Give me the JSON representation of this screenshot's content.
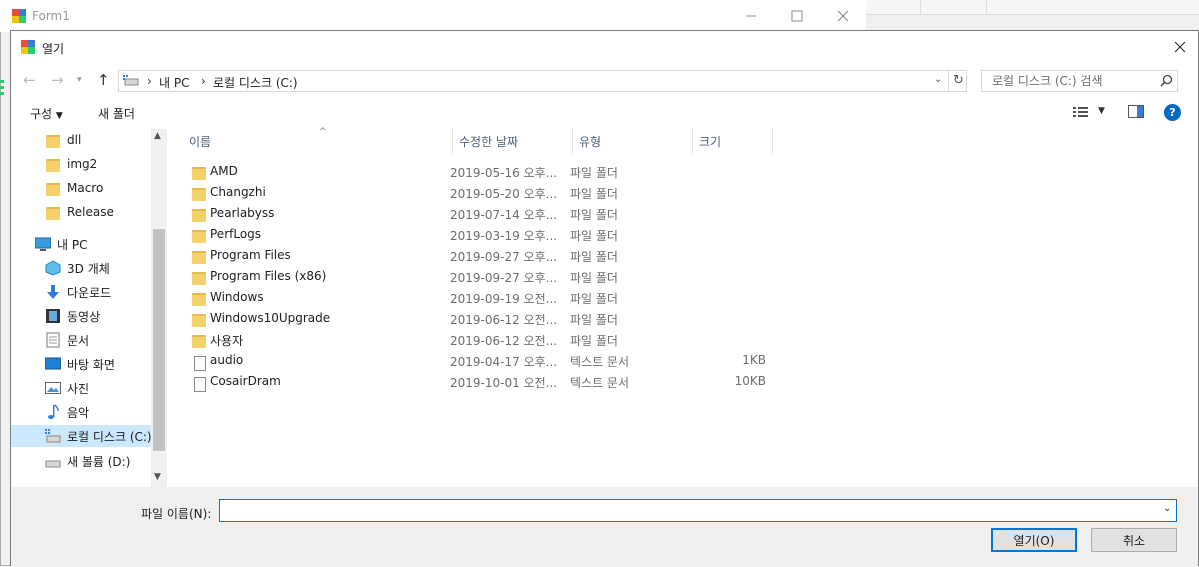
{
  "background_window": {
    "title": "Form1"
  },
  "dialog": {
    "title": "열기"
  },
  "address": {
    "segments": [
      "내 PC",
      "로컬 디스크 (C:)"
    ]
  },
  "search": {
    "placeholder": "로컬 디스크 (C:) 검색"
  },
  "toolbar": {
    "organize_label": "구성",
    "new_folder_label": "새 폴더"
  },
  "nav": {
    "items": [
      {
        "label": "dll",
        "icon": "folder-icon"
      },
      {
        "label": "img2",
        "icon": "folder-icon"
      },
      {
        "label": "Macro",
        "icon": "folder-icon"
      },
      {
        "label": "Release",
        "icon": "folder-icon"
      },
      {
        "label": "내 PC",
        "icon": "computer-icon"
      },
      {
        "label": "3D 개체",
        "icon": "3d-objects-icon"
      },
      {
        "label": "다운로드",
        "icon": "download-icon"
      },
      {
        "label": "동영상",
        "icon": "video-icon"
      },
      {
        "label": "문서",
        "icon": "documents-icon"
      },
      {
        "label": "바탕 화면",
        "icon": "desktop-icon"
      },
      {
        "label": "사진",
        "icon": "pictures-icon"
      },
      {
        "label": "음악",
        "icon": "music-icon"
      },
      {
        "label": "로컬 디스크 (C:)",
        "icon": "drive-icon",
        "selected": true
      },
      {
        "label": "새 볼륨 (D:)",
        "icon": "drive-icon"
      }
    ]
  },
  "columns": [
    "이름",
    "수정한 날짜",
    "유형",
    "크기"
  ],
  "files": [
    {
      "name": "AMD",
      "date": "2019-05-16 오후...",
      "type": "파일 폴더",
      "size": "",
      "kind": "folder"
    },
    {
      "name": "Changzhi",
      "date": "2019-05-20 오후...",
      "type": "파일 폴더",
      "size": "",
      "kind": "folder"
    },
    {
      "name": "Pearlabyss",
      "date": "2019-07-14 오후...",
      "type": "파일 폴더",
      "size": "",
      "kind": "folder"
    },
    {
      "name": "PerfLogs",
      "date": "2019-03-19 오후...",
      "type": "파일 폴더",
      "size": "",
      "kind": "folder"
    },
    {
      "name": "Program Files",
      "date": "2019-09-27 오후...",
      "type": "파일 폴더",
      "size": "",
      "kind": "folder"
    },
    {
      "name": "Program Files (x86)",
      "date": "2019-09-27 오후...",
      "type": "파일 폴더",
      "size": "",
      "kind": "folder"
    },
    {
      "name": "Windows",
      "date": "2019-09-19 오전...",
      "type": "파일 폴더",
      "size": "",
      "kind": "folder"
    },
    {
      "name": "Windows10Upgrade",
      "date": "2019-06-12 오전...",
      "type": "파일 폴더",
      "size": "",
      "kind": "folder"
    },
    {
      "name": "사용자",
      "date": "2019-06-12 오전...",
      "type": "파일 폴더",
      "size": "",
      "kind": "folder"
    },
    {
      "name": "audio",
      "date": "2019-04-17 오후...",
      "type": "텍스트 문서",
      "size": "1KB",
      "kind": "doc"
    },
    {
      "name": "CosairDram",
      "date": "2019-10-01 오전...",
      "type": "텍스트 문서",
      "size": "10KB",
      "kind": "doc"
    }
  ],
  "bottom": {
    "filename_label": "파일 이름(N):",
    "filename_value": "",
    "open_label": "열기(O)",
    "cancel_label": "취소"
  },
  "colors": {
    "accent": "#0078d7",
    "selection": "#cce8ff",
    "folder": "#f3d26b"
  }
}
